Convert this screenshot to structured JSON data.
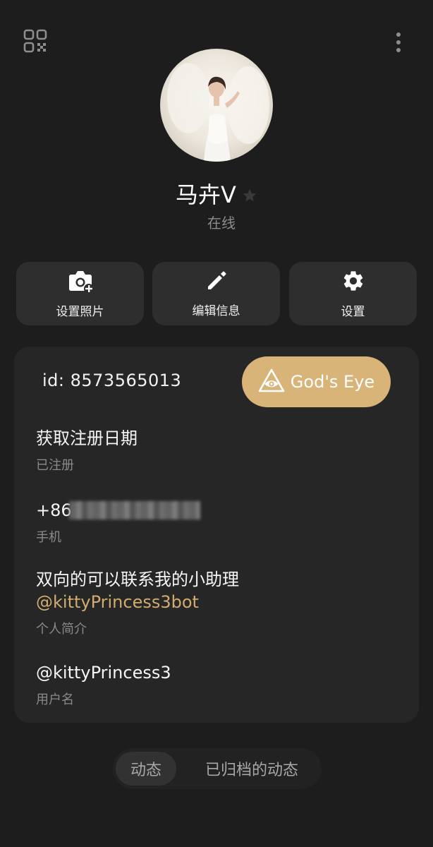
{
  "header": {
    "qr_icon": "qr-code-icon",
    "more_icon": "more-vertical-icon"
  },
  "profile": {
    "name": "马卉V",
    "status": "在线",
    "star_icon": "star-icon"
  },
  "actions": [
    {
      "label": "设置照片",
      "icon": "camera-add-icon"
    },
    {
      "label": "编辑信息",
      "icon": "pencil-icon"
    },
    {
      "label": "设置",
      "icon": "gear-icon"
    }
  ],
  "card": {
    "id_text": "id: 8573565013",
    "gods_eye_label": "God's Eye",
    "gods_eye_color": "#d8b478",
    "registration": {
      "value": "获取注册日期",
      "caption": "已注册"
    },
    "phone": {
      "value": "+86",
      "caption": "手机"
    },
    "bio": {
      "line1": "双向的可以联系我的小助理",
      "link": "@kittyPrincess3bot",
      "caption": "个人简介"
    },
    "username": {
      "value": "@kittyPrincess3",
      "caption": "用户名"
    }
  },
  "tabs": [
    {
      "label": "动态",
      "active": true
    },
    {
      "label": "已归档的动态",
      "active": false
    }
  ],
  "colors": {
    "background": "#1d1d1d",
    "card": "#262626",
    "button": "#2e2e2e",
    "accent": "#d2ac6e"
  }
}
